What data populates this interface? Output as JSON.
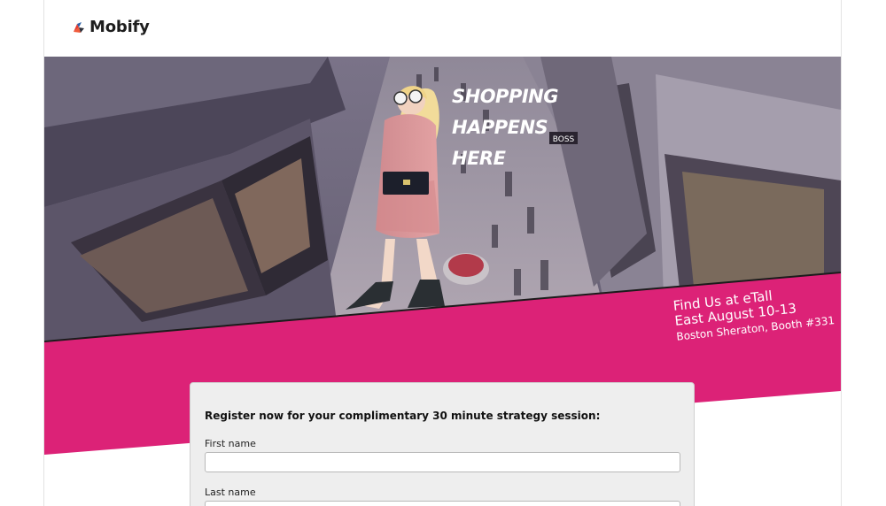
{
  "header": {
    "brand_name": "Mobify",
    "logo_icon": "mobify-logo-icon"
  },
  "hero": {
    "headline_lines": [
      "SHOPPING",
      "HAPPENS",
      "HERE"
    ],
    "image_description_icon": "mall-shopper-photo"
  },
  "event": {
    "line1": "Find Us at eTall",
    "line2": "East August 10-13",
    "line3": "Boston Sheraton, Booth #331"
  },
  "form": {
    "title": "Register now for your complimentary 30 minute strategy session:",
    "fields": [
      {
        "label": "First name",
        "value": "",
        "placeholder": ""
      },
      {
        "label": "Last name",
        "value": "",
        "placeholder": ""
      }
    ]
  },
  "colors": {
    "accent_pink": "#dc2277",
    "photo_tint": "#5e5870",
    "frame_border": "#e3e3e3",
    "form_background": "#eeeeee"
  }
}
